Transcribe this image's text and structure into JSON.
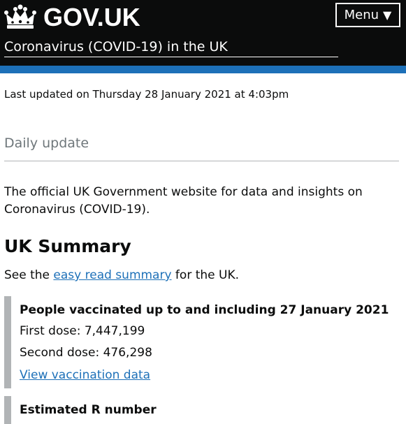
{
  "header": {
    "logo_text": "GOV.UK",
    "service_name": "Coronavirus (COVID-19) in the UK",
    "menu_label": "Menu",
    "menu_icon": "triangle-down-icon",
    "crown_icon": "crown-icon"
  },
  "colors": {
    "header_bg": "#0b0c0c",
    "accent_bar": "#1d70b8",
    "link": "#1d70b8",
    "card_border": "#b1b4b6",
    "muted_text": "#6f777b"
  },
  "meta": {
    "last_updated": "Last updated on Thursday 28 January 2021 at 4:03pm"
  },
  "tabs": {
    "current": "Daily update"
  },
  "intro": {
    "text": "The official UK Government website for data and insights on Coronavirus (COVID-19)."
  },
  "summary": {
    "heading": "UK Summary",
    "see_prefix": "See the ",
    "see_link": "easy read summary",
    "see_suffix": " for the UK."
  },
  "cards": [
    {
      "title": "People vaccinated up to and including 27 January 2021",
      "lines": [
        "First dose: 7,447,199",
        "Second dose: 476,298"
      ],
      "link": "View vaccination data"
    },
    {
      "title": "Estimated R number"
    }
  ]
}
